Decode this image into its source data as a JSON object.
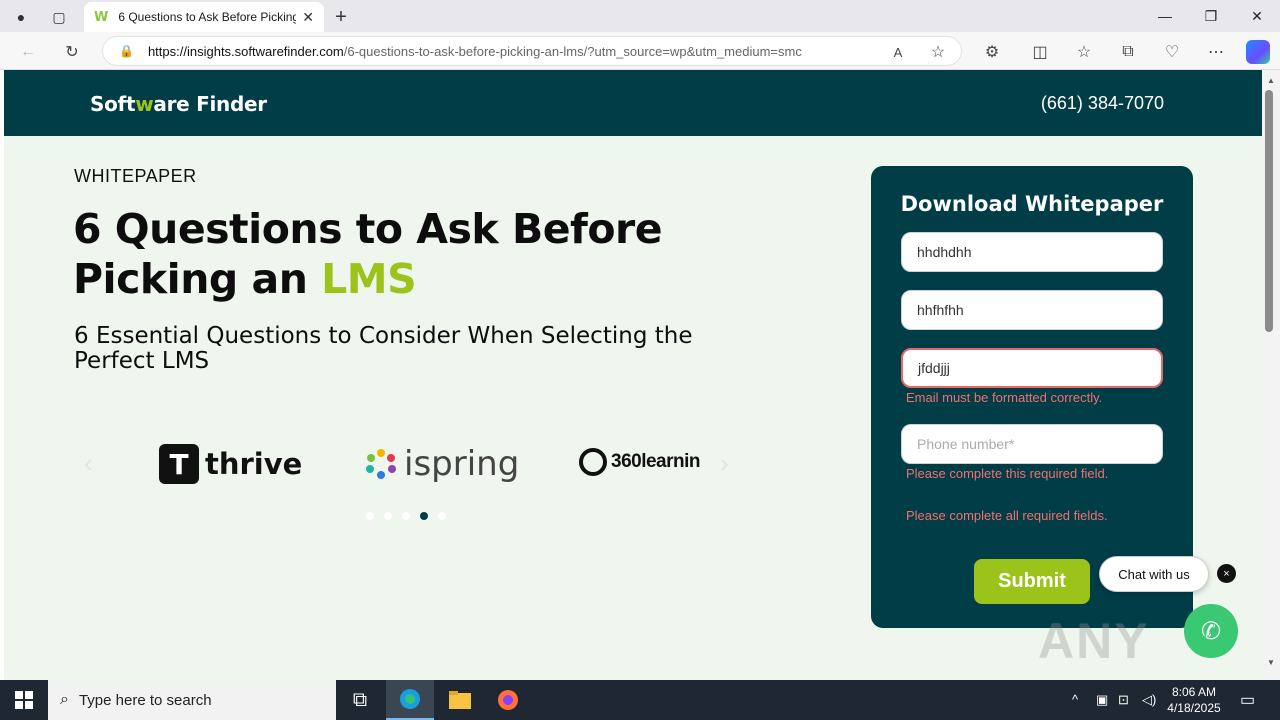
{
  "browser": {
    "tab_title": "6 Questions to Ask Before Picking",
    "url_host": "https://insights.softwarefinder.com",
    "url_path": "/6-questions-to-ask-before-picking-an-lms/?utm_source=wp&utm_medium=smc"
  },
  "site": {
    "logo_prefix": "Soft",
    "logo_w": "w",
    "logo_suffix": "are Finder",
    "phone": "(661) 384-7070"
  },
  "hero": {
    "kicker": "WHITEPAPER",
    "title_part1": "6 Questions to Ask Before Picking an ",
    "title_highlight": "LMS",
    "subtitle": "6 Essential Questions to Consider When Selecting the Perfect LMS"
  },
  "carousel": {
    "brands": [
      {
        "mark": "T",
        "name": "thrive"
      },
      {
        "name": "ispring"
      },
      {
        "name": "360learnin"
      }
    ],
    "dot_count": 5,
    "active_dot": 4
  },
  "form": {
    "title": "Download Whitepaper",
    "first_name_value": "hhdhdhh",
    "last_name_value": "hhfhfhh",
    "email_value": "jfddjjj",
    "email_error": "Email must be formatted correctly.",
    "phone_placeholder": "Phone number*",
    "phone_error": "Please complete this required field.",
    "form_error": "Please complete all required fields.",
    "submit_label": "Submit"
  },
  "chat": {
    "label": "Chat with us",
    "close": "×"
  },
  "watermark": "ANY RUN",
  "taskbar": {
    "search_placeholder": "Type here to search",
    "time": "8:06 AM",
    "date": "4/18/2025"
  },
  "colors": {
    "header_bg": "#003d47",
    "accent_green": "#9cc31a",
    "page_bg": "#eef6ee",
    "error": "#f07070"
  }
}
